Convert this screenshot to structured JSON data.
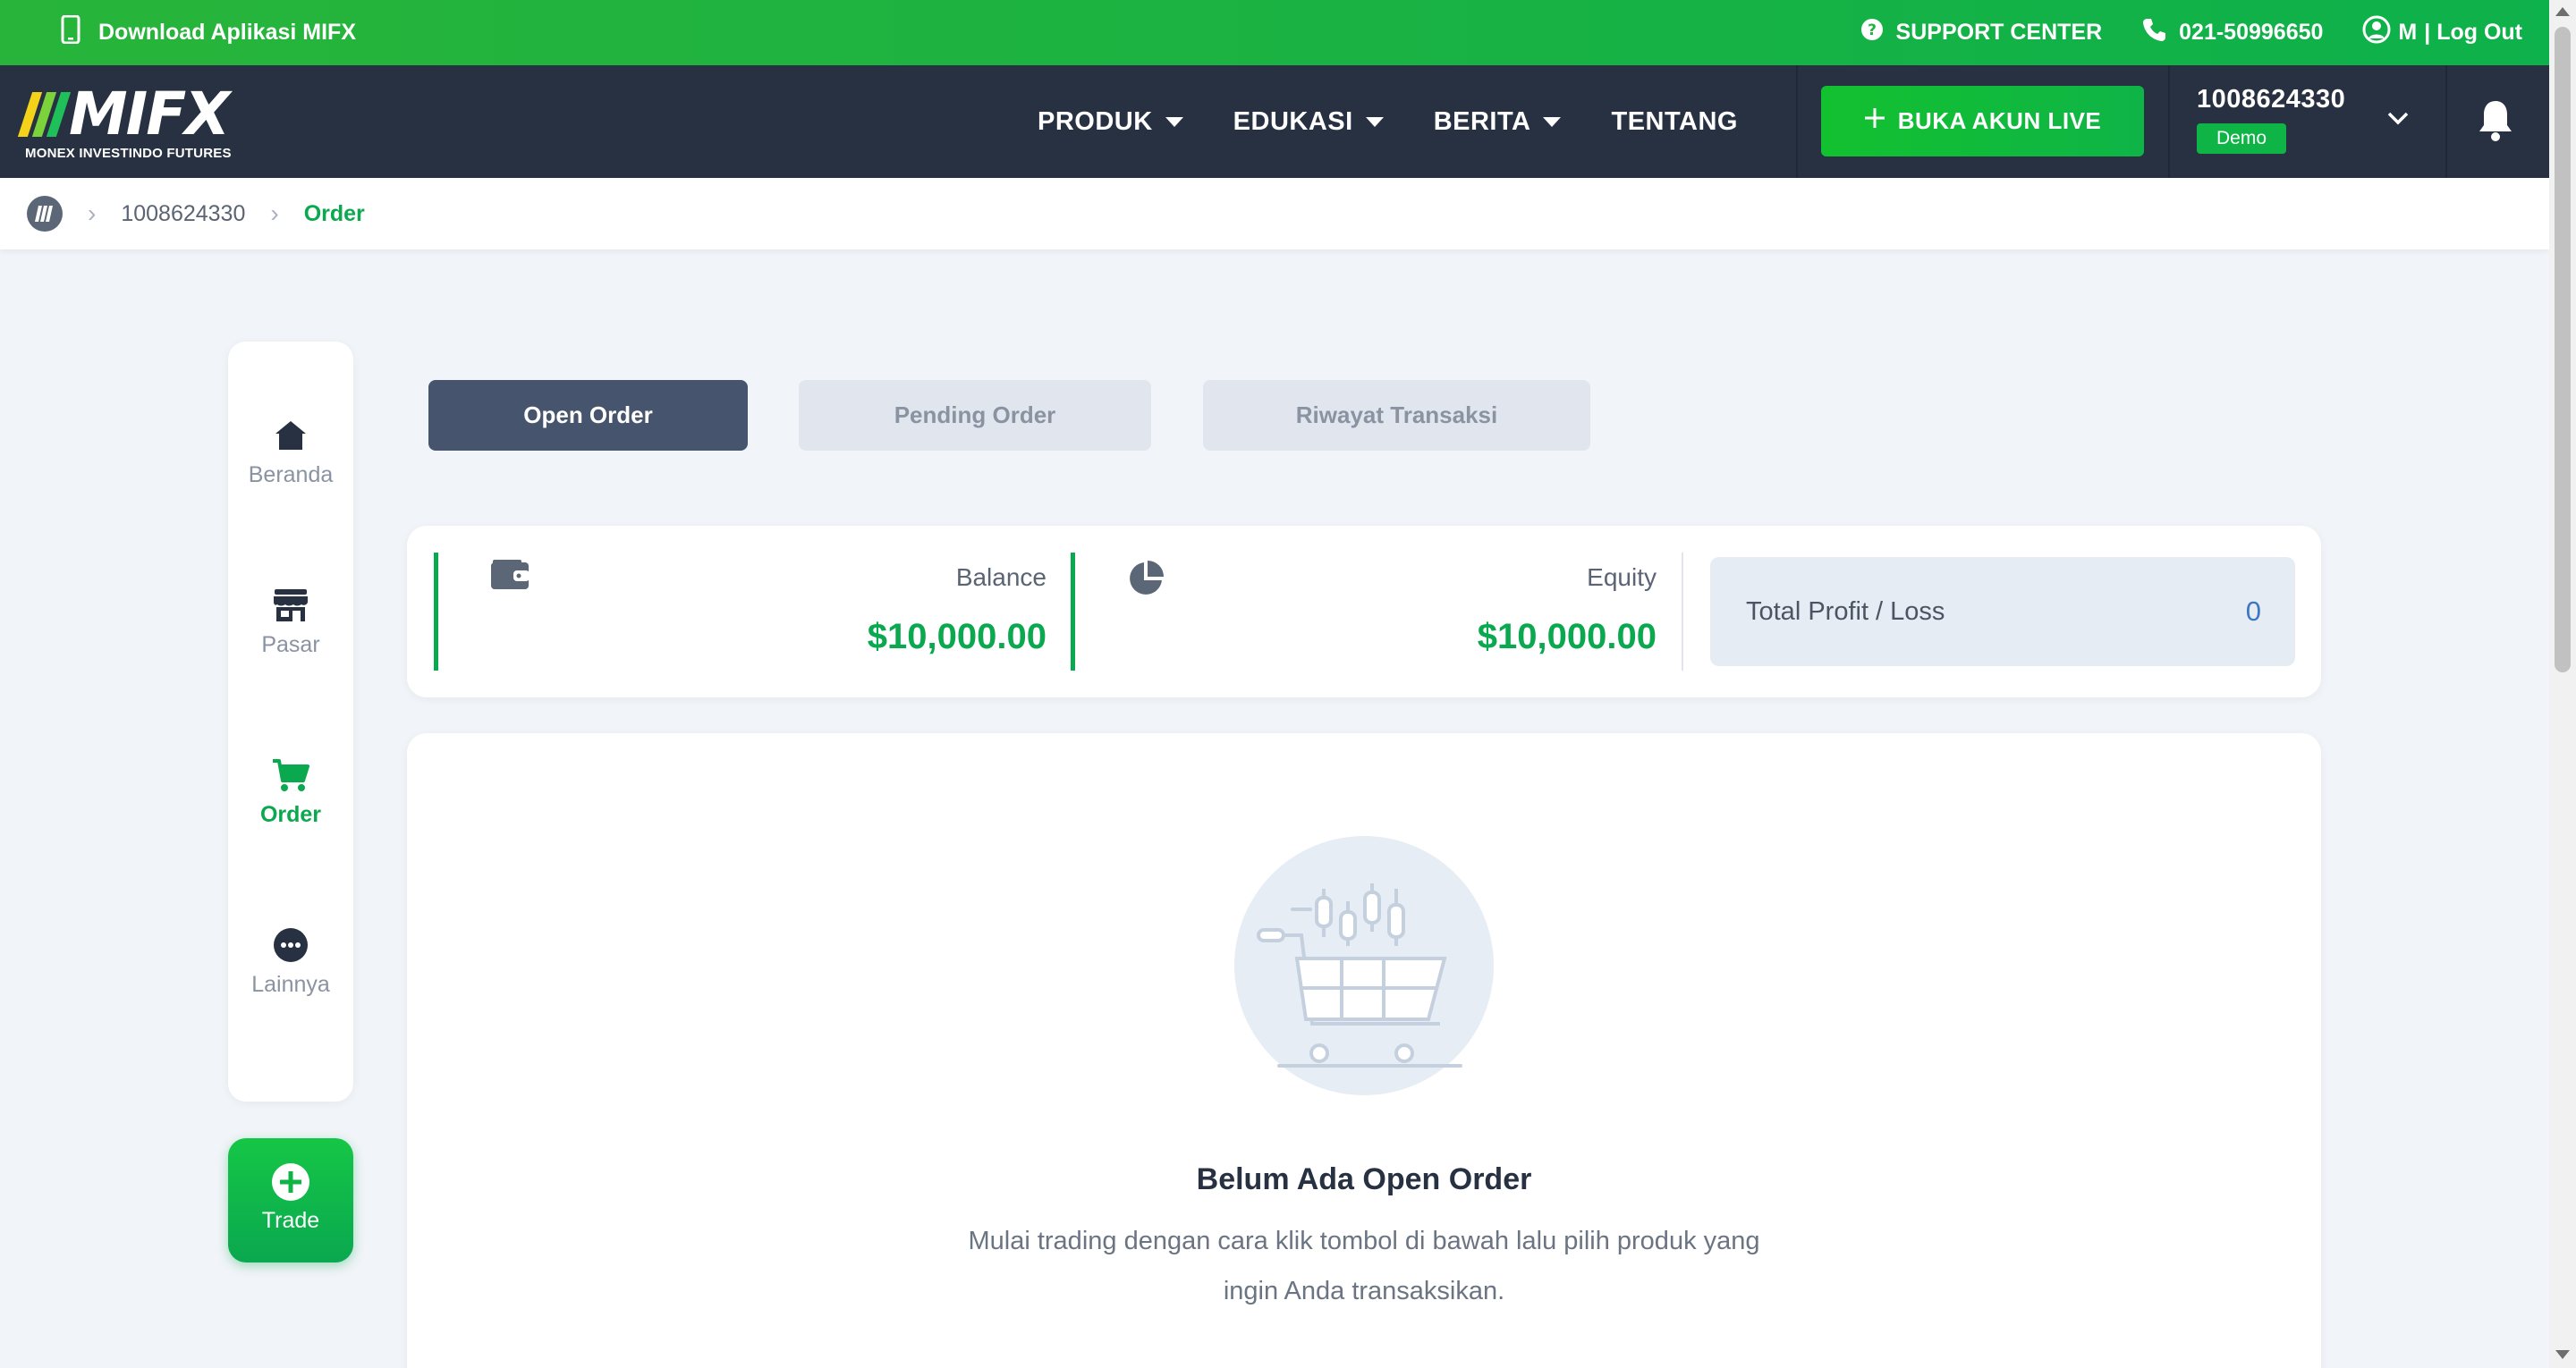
{
  "topbar": {
    "download_label": "Download Aplikasi MIFX",
    "support_label": "SUPPORT CENTER",
    "phone": "021-50996650",
    "user_initial": "M",
    "logout_label": "| Log Out"
  },
  "navbar": {
    "logo_text": "MIFX",
    "logo_subtitle": "MONEX INVESTINDO FUTURES",
    "menu": [
      {
        "label": "PRODUK"
      },
      {
        "label": "EDUKASI"
      },
      {
        "label": "BERITA"
      },
      {
        "label": "TENTANG"
      }
    ],
    "live_button": "BUKA AKUN LIVE",
    "account_number": "1008624330",
    "account_badge": "Demo"
  },
  "breadcrumb": {
    "account": "1008624330",
    "current": "Order"
  },
  "sidenav": {
    "items": [
      {
        "label": "Beranda",
        "icon": "home-icon"
      },
      {
        "label": "Pasar",
        "icon": "store-icon"
      },
      {
        "label": "Order",
        "icon": "cart-icon"
      },
      {
        "label": "Lainnya",
        "icon": "more-icon"
      }
    ],
    "trade_label": "Trade"
  },
  "tabs": [
    {
      "label": "Open Order",
      "active": true
    },
    {
      "label": "Pending Order",
      "active": false
    },
    {
      "label": "Riwayat Transaksi",
      "active": false
    }
  ],
  "summary": {
    "balance_label": "Balance",
    "balance_value": "$10,000.00",
    "equity_label": "Equity",
    "equity_value": "$10,000.00",
    "pl_label": "Total Profit / Loss",
    "pl_value": "0"
  },
  "empty_state": {
    "title": "Belum Ada Open Order",
    "description": "Mulai trading dengan cara klik tombol di bawah lalu pilih produk yang ingin Anda transaksikan."
  },
  "colors": {
    "brand_green": "#0aa84f",
    "navbar": "#273142",
    "tab_active": "#46546d"
  }
}
